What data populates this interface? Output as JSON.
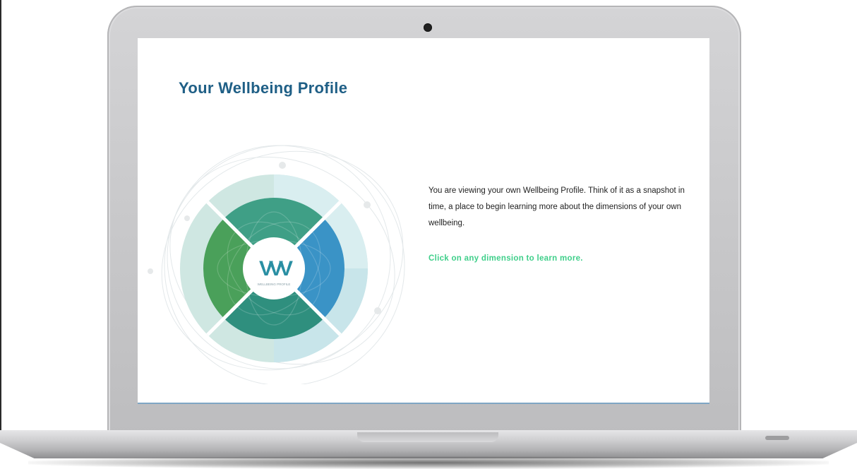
{
  "profile": {
    "title": "Your Wellbeing Profile",
    "logo_letters": "VVV",
    "logo_caption": "WELLBEING PROFILE",
    "description": "You are viewing your own Wellbeing Profile. Think of it as a snapshot in time, a place to begin learning more about the dimensions of your own wellbeing.",
    "cta": "Click on any dimension to learn more."
  },
  "colors": {
    "title": "#1f5f86",
    "cta": "#3fcf8a",
    "wheel_green": "#3f9e6a",
    "wheel_blue": "#3a93c6",
    "wheel_teal": "#2f8f8a"
  },
  "device": "laptop"
}
